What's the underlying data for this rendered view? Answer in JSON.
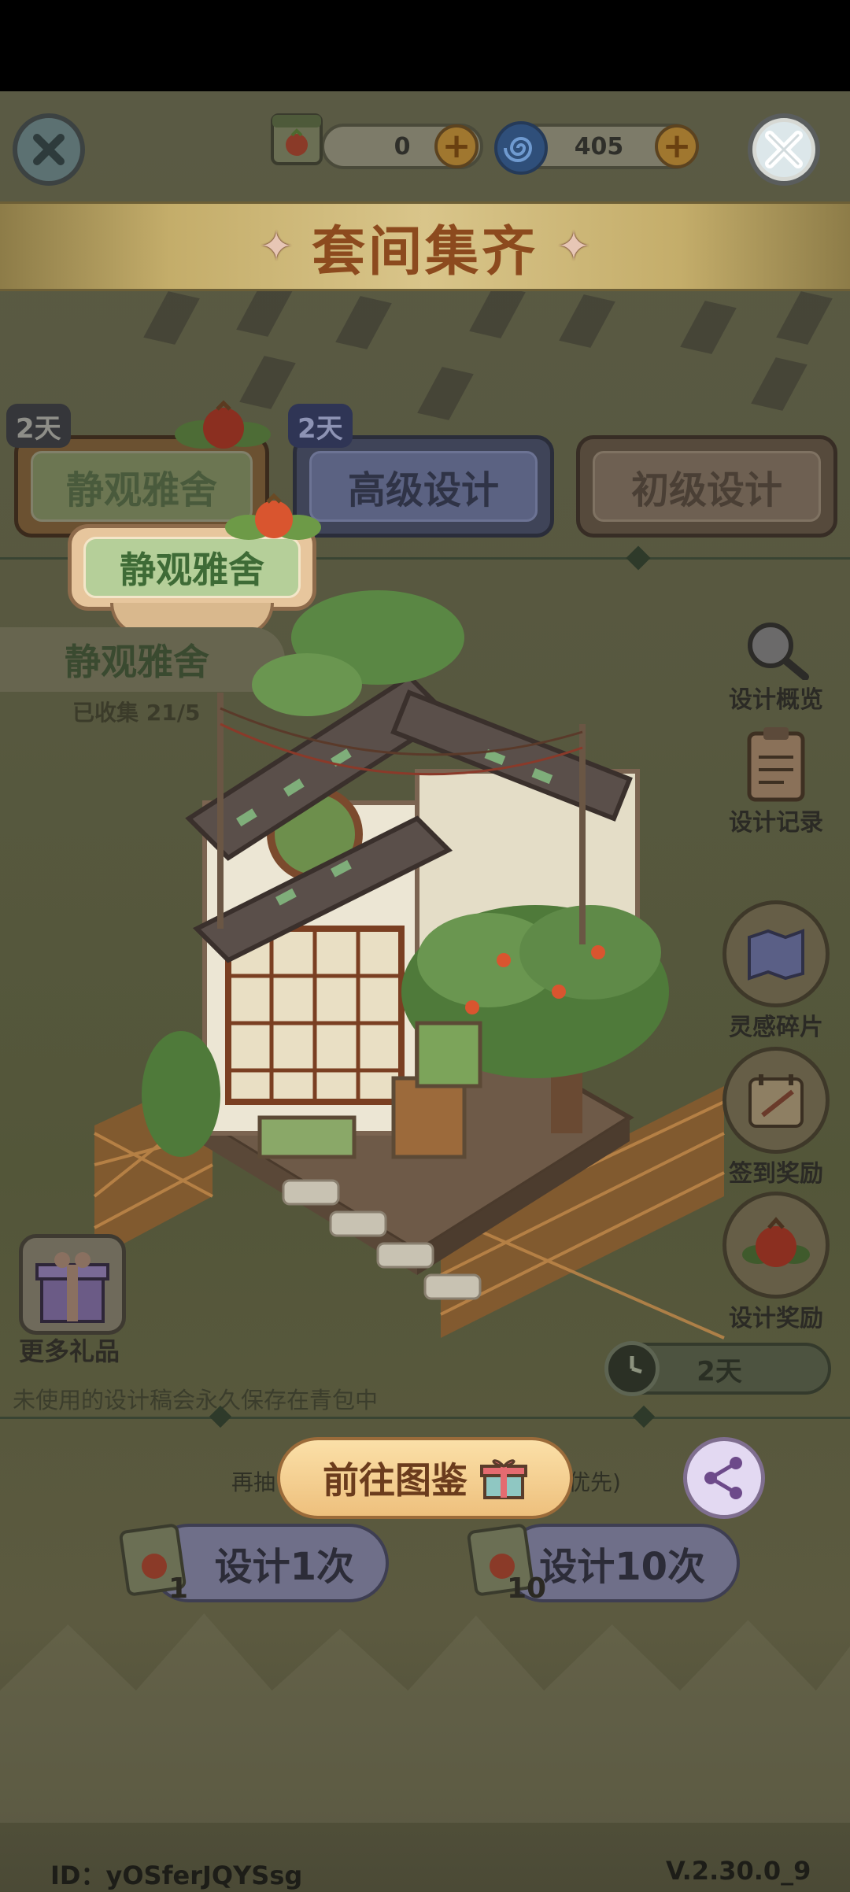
{
  "header": {
    "currency_seeds": "0",
    "currency_spiral": "405",
    "title": "套间集齐"
  },
  "tabs": [
    {
      "label": "静观雅舍",
      "badge": "2天"
    },
    {
      "label": "高级设计",
      "badge": "2天"
    },
    {
      "label": "初级设计"
    }
  ],
  "set": {
    "active_tag": "静观雅舍",
    "name": "静观雅舍",
    "collected": "已收集 21/",
    "collected_suffix": "5"
  },
  "side_menu": [
    {
      "label": "设计概览",
      "icon": "magnifier-icon"
    },
    {
      "label": "设计记录",
      "icon": "clipboard-icon"
    },
    {
      "label": "灵感碎片",
      "icon": "map-icon"
    },
    {
      "label": "签到奖励",
      "icon": "calendar-icon"
    },
    {
      "label": "设计奖励",
      "icon": "pomegranate-icon"
    }
  ],
  "more_gifts": "更多礼品",
  "timer": "2天",
  "note": "未使用的设计稿会永久保存在青包中",
  "goto_button": "前往图鉴",
  "redraw_hint_left": "再抽",
  "redraw_hint_right": "优先)",
  "design_once": {
    "label": "设计1次",
    "cost": "1"
  },
  "design_ten": {
    "label": "设计10次",
    "cost": "10"
  },
  "footer": {
    "id": "ID：yOSferJQYSsg",
    "version": "V.2.30.0_9"
  },
  "colors": {
    "title_text": "#8c4a1e",
    "banner": "#d9c58a",
    "goto_button": "#eec07d"
  }
}
